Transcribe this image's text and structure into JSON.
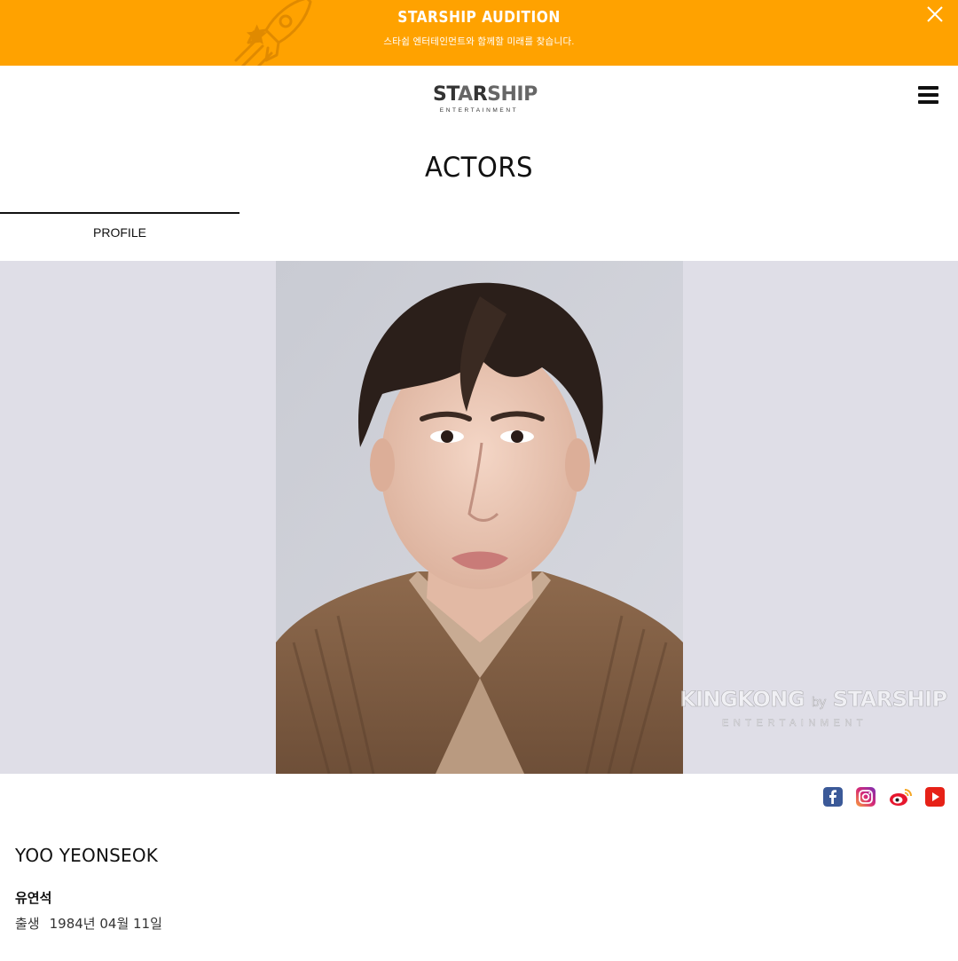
{
  "banner": {
    "title": "STARSHIP AUDITION",
    "subtitle": "스타쉽 엔터테인먼트와 함께할 미래를 찾습니다.",
    "close_icon": "close-icon",
    "background_color": "#ffa200"
  },
  "header": {
    "logo_text_a": "ST",
    "logo_text_b": "R",
    "logo_text_c": "SHIP",
    "logo_sub": "ENTERTAINMENT",
    "menu_icon": "hamburger-icon"
  },
  "page": {
    "title": "ACTORS"
  },
  "tabs": [
    {
      "label": "PROFILE",
      "active": true
    }
  ],
  "photo": {
    "watermark_main_a": "KINGKONG",
    "watermark_by": "by",
    "watermark_main_b": "STARSHIP",
    "watermark_sub": "ENTERTAINMENT"
  },
  "social": [
    {
      "name": "facebook-icon",
      "color": "#3b5998"
    },
    {
      "name": "instagram-icon",
      "color": "#c13584"
    },
    {
      "name": "weibo-icon",
      "color": "#e6162d"
    },
    {
      "name": "youtube-icon",
      "color": "#e62117"
    }
  ],
  "profile": {
    "name_en": "YOO YEONSEOK",
    "name_ko": "유연석",
    "birth_label": "출생",
    "birth_value": "1984년 04월 11일"
  }
}
